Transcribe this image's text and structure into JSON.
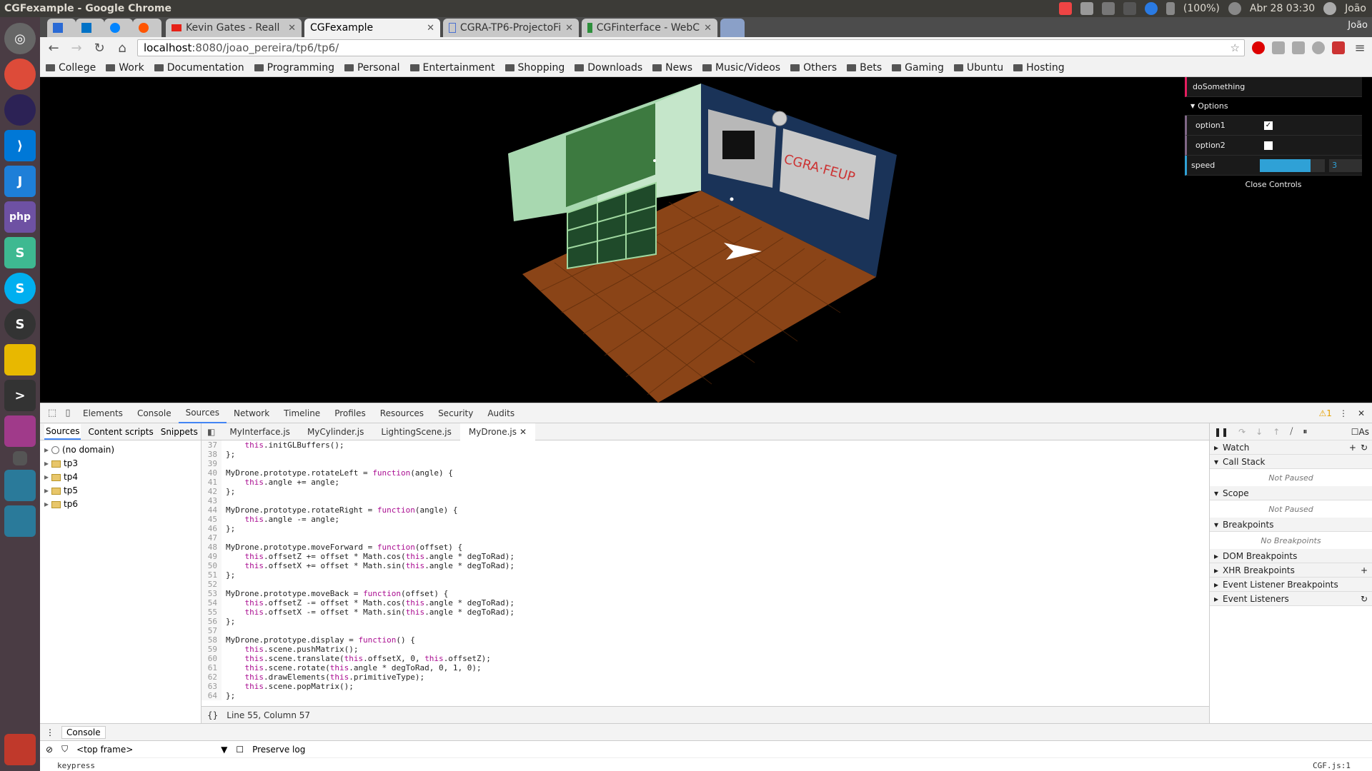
{
  "system": {
    "window_title": "CGFexample - Google Chrome",
    "battery": "(100%)",
    "datetime": "Abr 28 03:30",
    "user": "João"
  },
  "tabs": [
    {
      "label": "Kevin Gates - Reall"
    },
    {
      "label": "CGFexample"
    },
    {
      "label": "CGRA-TP6-ProjectoFi"
    },
    {
      "label": "CGFinterface - WebC"
    }
  ],
  "tab_user": "João",
  "address": {
    "host": "localhost",
    "rest": ":8080/joao_pereira/tp6/tp6/"
  },
  "bookmarks": [
    "College",
    "Work",
    "Documentation",
    "Programming",
    "Personal",
    "Entertainment",
    "Shopping",
    "Downloads",
    "News",
    "Music/Videos",
    "Others",
    "Bets",
    "Gaming",
    "Ubuntu",
    "Hosting"
  ],
  "gui": {
    "do_something": "doSomething",
    "options_label": "Options",
    "option1": "option1",
    "option2": "option2",
    "option1_checked": true,
    "option2_checked": false,
    "speed_label": "speed",
    "speed_value": "3",
    "speed_fraction": 0.78,
    "close": "Close Controls"
  },
  "devtools": {
    "tabs": [
      "Elements",
      "Console",
      "Sources",
      "Network",
      "Timeline",
      "Profiles",
      "Resources",
      "Security",
      "Audits"
    ],
    "warning_count": "1",
    "nav_tabs": [
      "Sources",
      "Content scripts",
      "Snippets"
    ],
    "tree": [
      "(no domain)",
      "tp3",
      "tp4",
      "tp5",
      "tp6"
    ],
    "editor_tabs": [
      "MyInterface.js",
      "MyCylinder.js",
      "LightingScene.js",
      "MyDrone.js"
    ],
    "code": [
      {
        "n": "37",
        "t": "    this.initGLBuffers();"
      },
      {
        "n": "38",
        "t": "};"
      },
      {
        "n": "39",
        "t": ""
      },
      {
        "n": "40",
        "t": "MyDrone.prototype.rotateLeft = function(angle) {"
      },
      {
        "n": "41",
        "t": "    this.angle += angle;"
      },
      {
        "n": "42",
        "t": "};"
      },
      {
        "n": "43",
        "t": ""
      },
      {
        "n": "44",
        "t": "MyDrone.prototype.rotateRight = function(angle) {"
      },
      {
        "n": "45",
        "t": "    this.angle -= angle;"
      },
      {
        "n": "46",
        "t": "};"
      },
      {
        "n": "47",
        "t": ""
      },
      {
        "n": "48",
        "t": "MyDrone.prototype.moveForward = function(offset) {"
      },
      {
        "n": "49",
        "t": "    this.offsetZ += offset * Math.cos(this.angle * degToRad);"
      },
      {
        "n": "50",
        "t": "    this.offsetX += offset * Math.sin(this.angle * degToRad);"
      },
      {
        "n": "51",
        "t": "};"
      },
      {
        "n": "52",
        "t": ""
      },
      {
        "n": "53",
        "t": "MyDrone.prototype.moveBack = function(offset) {"
      },
      {
        "n": "54",
        "t": "    this.offsetZ -= offset * Math.cos(this.angle * degToRad);"
      },
      {
        "n": "55",
        "t": "    this.offsetX -= offset * Math.sin(this.angle * degToRad);"
      },
      {
        "n": "56",
        "t": "};"
      },
      {
        "n": "57",
        "t": ""
      },
      {
        "n": "58",
        "t": "MyDrone.prototype.display = function() {"
      },
      {
        "n": "59",
        "t": "    this.scene.pushMatrix();"
      },
      {
        "n": "60",
        "t": "    this.scene.translate(this.offsetX, 0, this.offsetZ);"
      },
      {
        "n": "61",
        "t": "    this.scene.rotate(this.angle * degToRad, 0, 1, 0);"
      },
      {
        "n": "62",
        "t": "    this.drawElements(this.primitiveType);"
      },
      {
        "n": "63",
        "t": "    this.scene.popMatrix();"
      },
      {
        "n": "64",
        "t": "};"
      }
    ],
    "status": "Line 55, Column 57",
    "debug": {
      "watch": "Watch",
      "callstack": "Call Stack",
      "not_paused": "Not Paused",
      "scope": "Scope",
      "breakpoints": "Breakpoints",
      "no_breakpoints": "No Breakpoints",
      "dom_bp": "DOM Breakpoints",
      "xhr_bp": "XHR Breakpoints",
      "event_bp": "Event Listener Breakpoints",
      "event_listeners": "Event Listeners",
      "async": "As"
    },
    "drawer_tab": "Console",
    "frame": "<top frame>",
    "preserve_log": "Preserve log",
    "console_line": "keypress",
    "console_src": "CGF.js:1"
  },
  "colors": {
    "accent": "#4285f4",
    "gui_bar": "#2fa1d6"
  }
}
